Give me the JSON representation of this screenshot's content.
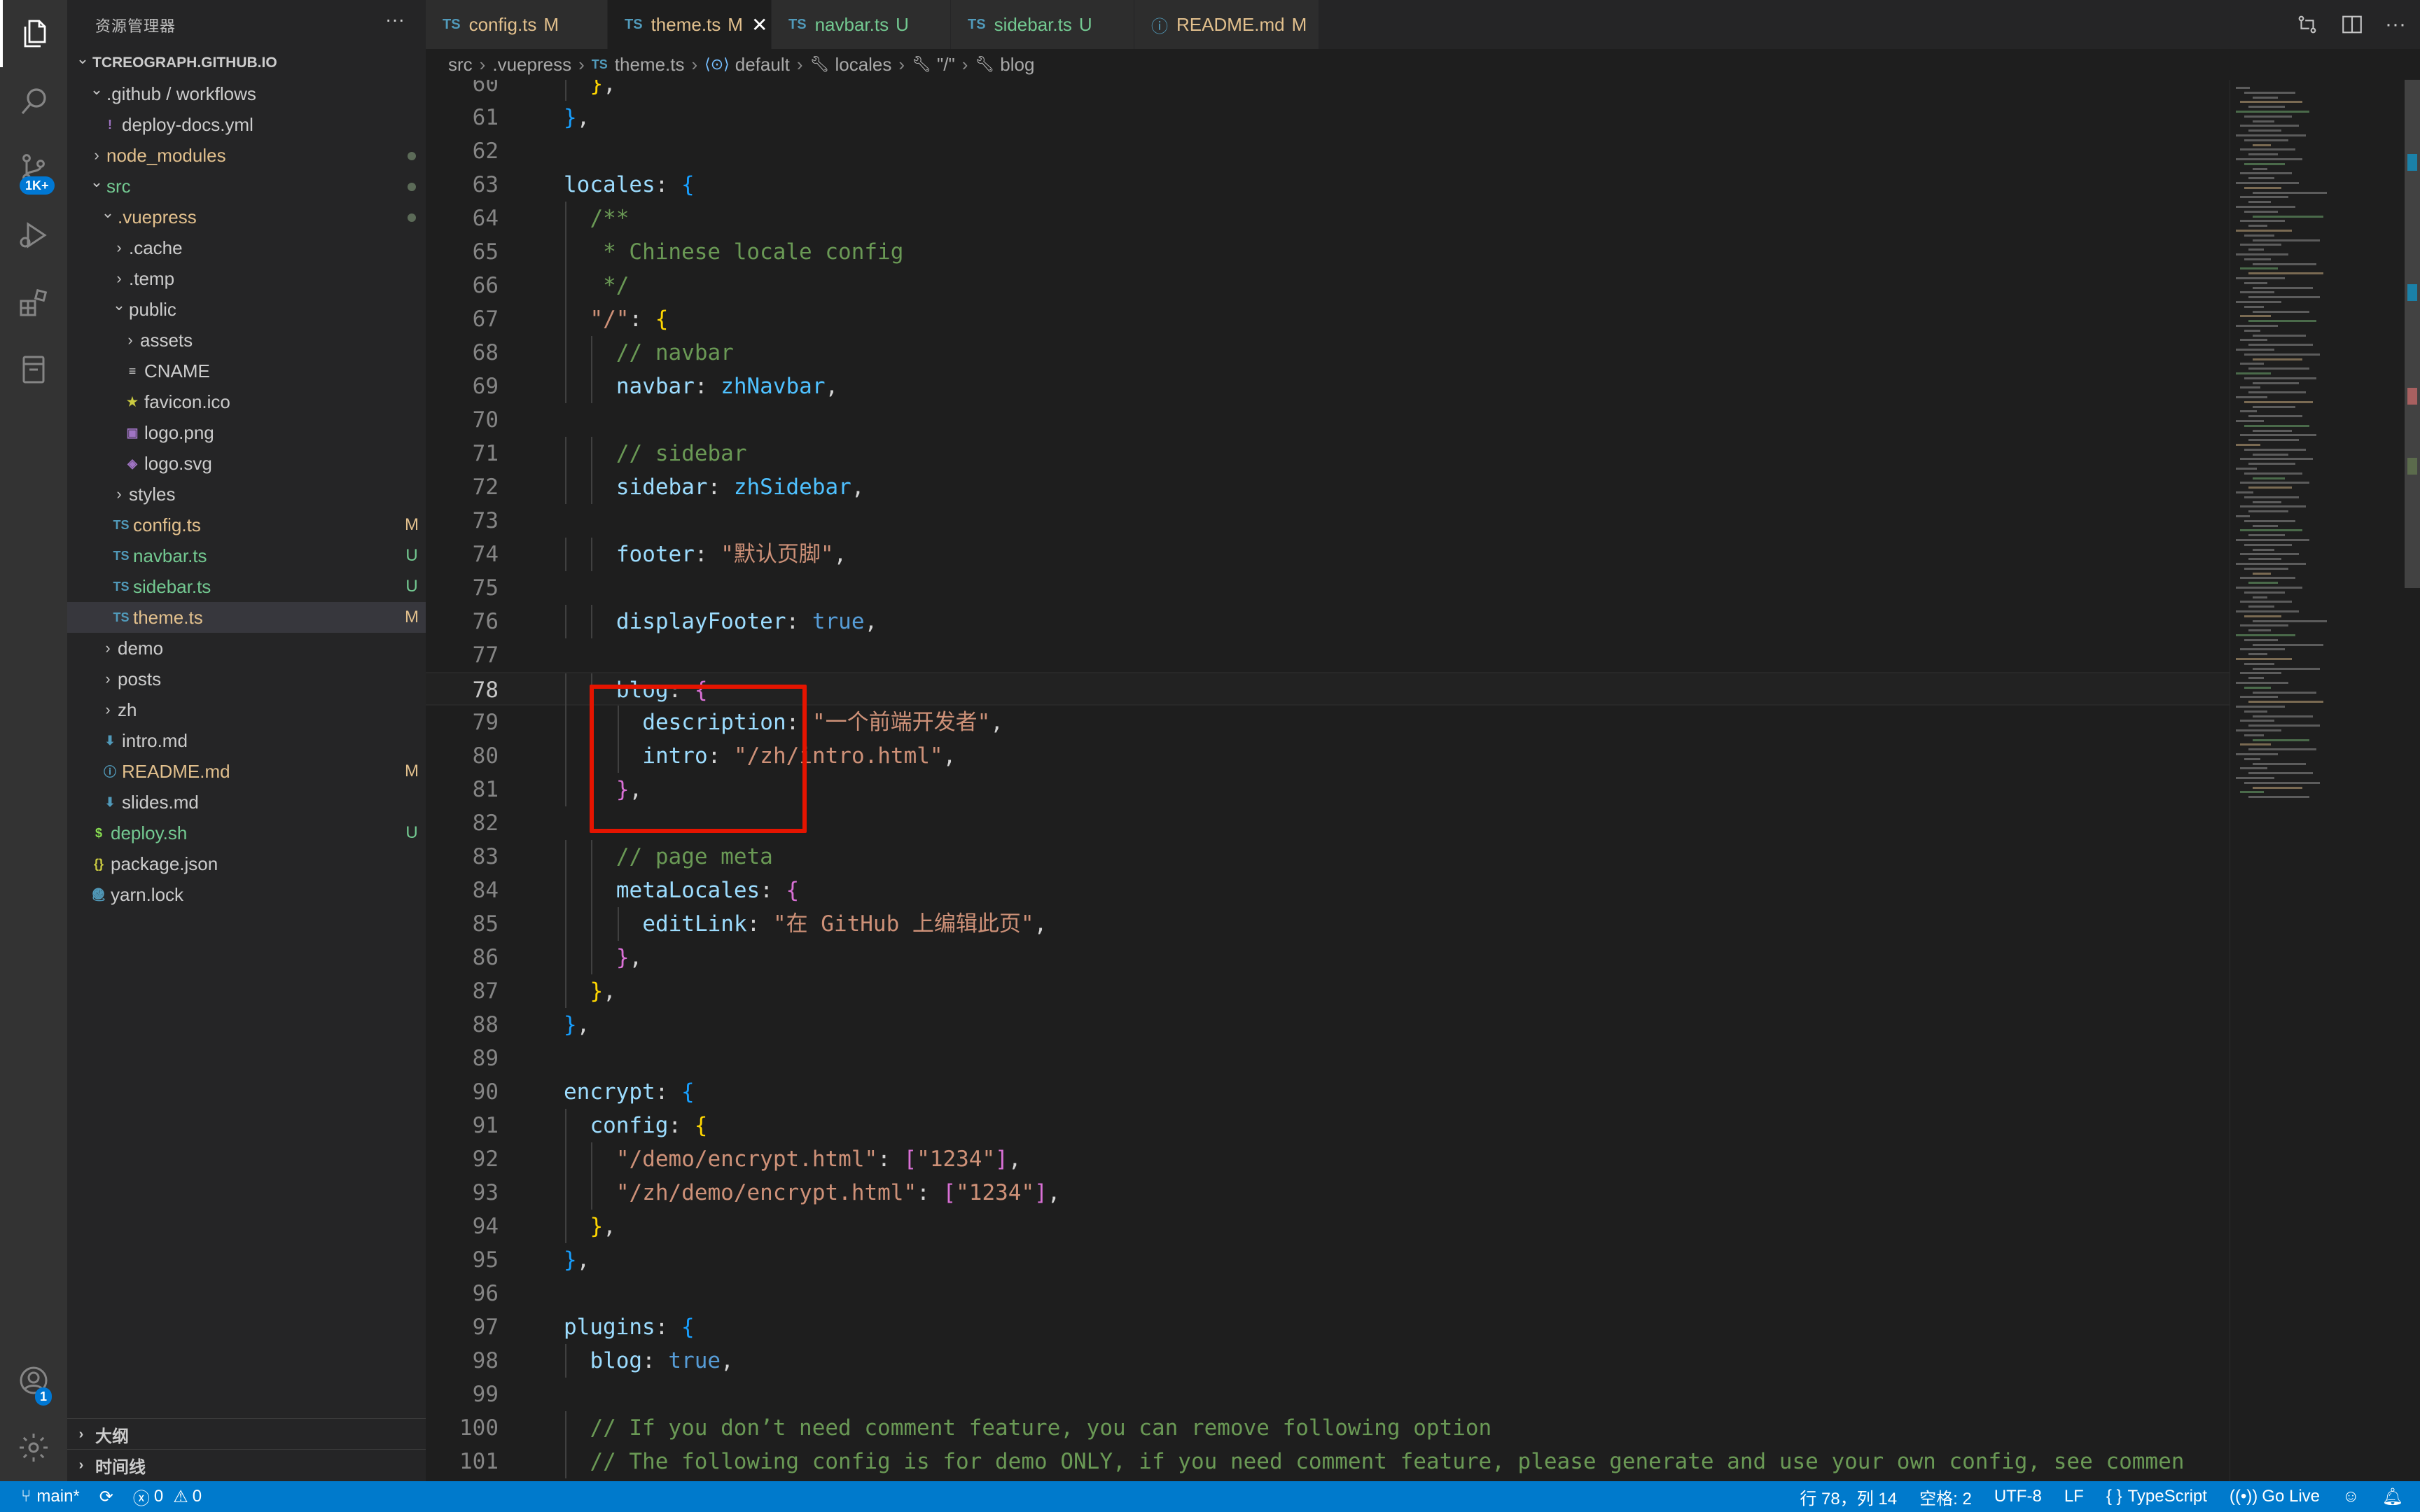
{
  "colors": {
    "accent": "#007acc",
    "modified": "#e2c08d",
    "untracked": "#73c991",
    "highlight_box": "#e51400"
  },
  "activity_bar": {
    "scm_badge": "1K+",
    "account_badge": "1"
  },
  "explorer": {
    "title": "资源管理器",
    "more": "···",
    "tree": [
      {
        "label": "TCREOGRAPH.GITHUB.IO",
        "type": "root",
        "depth": 0,
        "expanded": true,
        "status": ""
      },
      {
        "label": ".github / workflows",
        "type": "folder",
        "depth": 1,
        "expanded": true,
        "status": ""
      },
      {
        "label": "deploy-docs.yml",
        "type": "yml",
        "depth": 2,
        "status": ""
      },
      {
        "label": "node_modules",
        "type": "folder",
        "depth": 1,
        "expanded": false,
        "status": "dot",
        "color": "mod"
      },
      {
        "label": "src",
        "type": "folder",
        "depth": 1,
        "expanded": true,
        "status": "dot",
        "color": "new"
      },
      {
        "label": ".vuepress",
        "type": "folder",
        "depth": 2,
        "expanded": true,
        "status": "dot",
        "color": "mod"
      },
      {
        "label": ".cache",
        "type": "folder",
        "depth": 3,
        "expanded": false,
        "status": ""
      },
      {
        "label": ".temp",
        "type": "folder",
        "depth": 3,
        "expanded": false,
        "status": ""
      },
      {
        "label": "public",
        "type": "folder",
        "depth": 3,
        "expanded": true,
        "status": ""
      },
      {
        "label": "assets",
        "type": "folder",
        "depth": 4,
        "expanded": false,
        "status": ""
      },
      {
        "label": "CNAME",
        "type": "text",
        "depth": 4,
        "status": ""
      },
      {
        "label": "favicon.ico",
        "type": "star",
        "depth": 4,
        "status": ""
      },
      {
        "label": "logo.png",
        "type": "image",
        "depth": 4,
        "status": ""
      },
      {
        "label": "logo.svg",
        "type": "svg",
        "depth": 4,
        "status": ""
      },
      {
        "label": "styles",
        "type": "folder",
        "depth": 3,
        "expanded": false,
        "status": ""
      },
      {
        "label": "config.ts",
        "type": "ts",
        "depth": 3,
        "status": "M",
        "color": "mod"
      },
      {
        "label": "navbar.ts",
        "type": "ts",
        "depth": 3,
        "status": "U",
        "color": "new"
      },
      {
        "label": "sidebar.ts",
        "type": "ts",
        "depth": 3,
        "status": "U",
        "color": "new"
      },
      {
        "label": "theme.ts",
        "type": "ts",
        "depth": 3,
        "status": "M",
        "color": "mod",
        "selected": true
      },
      {
        "label": "demo",
        "type": "folder",
        "depth": 2,
        "expanded": false,
        "status": ""
      },
      {
        "label": "posts",
        "type": "folder",
        "depth": 2,
        "expanded": false,
        "status": ""
      },
      {
        "label": "zh",
        "type": "folder",
        "depth": 2,
        "expanded": false,
        "status": ""
      },
      {
        "label": "intro.md",
        "type": "md",
        "depth": 2,
        "status": ""
      },
      {
        "label": "README.md",
        "type": "info",
        "depth": 2,
        "status": "M",
        "color": "mod"
      },
      {
        "label": "slides.md",
        "type": "md",
        "depth": 2,
        "status": ""
      },
      {
        "label": "deploy.sh",
        "type": "sh",
        "depth": 1,
        "status": "U",
        "color": "new"
      },
      {
        "label": "package.json",
        "type": "json",
        "depth": 1,
        "status": ""
      },
      {
        "label": "yarn.lock",
        "type": "lock",
        "depth": 1,
        "status": ""
      }
    ],
    "outline": "大纲",
    "timeline": "时间线"
  },
  "tabs": [
    {
      "label": "config.ts",
      "status": "M",
      "kind": "TS",
      "color": "mod",
      "active": false
    },
    {
      "label": "theme.ts",
      "status": "M",
      "kind": "TS",
      "color": "mod",
      "active": true
    },
    {
      "label": "navbar.ts",
      "status": "U",
      "kind": "TS",
      "color": "new",
      "active": false
    },
    {
      "label": "sidebar.ts",
      "status": "U",
      "kind": "TS",
      "color": "new",
      "active": false
    },
    {
      "label": "README.md",
      "status": "M",
      "kind": "info",
      "color": "mod",
      "active": false
    }
  ],
  "breadcrumb": {
    "src": "src",
    "vuepress": ".vuepress",
    "ts_tag": "TS",
    "file": "theme.ts",
    "default": "default",
    "locales": "locales",
    "root": "\"/\"",
    "blog": "blog"
  },
  "editor": {
    "current_line": 78,
    "lines": [
      {
        "n": 60,
        "indent": 1,
        "tokens": [
          [
            "}",
            "b1"
          ],
          [
            ",",
            "pl"
          ]
        ]
      },
      {
        "n": 61,
        "indent": 0,
        "tokens": [
          [
            "}",
            "b3"
          ],
          [
            ",",
            "pl"
          ]
        ]
      },
      {
        "n": 62,
        "indent": 0,
        "tokens": []
      },
      {
        "n": 63,
        "indent": 0,
        "tokens": [
          [
            "locales",
            "kw"
          ],
          [
            ": ",
            "pl"
          ],
          [
            "{",
            "b3"
          ]
        ]
      },
      {
        "n": 64,
        "indent": 1,
        "tokens": [
          [
            "/**",
            "cm"
          ]
        ]
      },
      {
        "n": 65,
        "indent": 1,
        "tokens": [
          [
            " * Chinese locale config",
            "cm"
          ]
        ]
      },
      {
        "n": 66,
        "indent": 1,
        "tokens": [
          [
            " */",
            "cm"
          ]
        ]
      },
      {
        "n": 67,
        "indent": 1,
        "tokens": [
          [
            "\"/\"",
            "str"
          ],
          [
            ": ",
            "pl"
          ],
          [
            "{",
            "b1"
          ]
        ]
      },
      {
        "n": 68,
        "indent": 2,
        "tokens": [
          [
            "// navbar",
            "cm"
          ]
        ]
      },
      {
        "n": 69,
        "indent": 2,
        "tokens": [
          [
            "navbar",
            "kw"
          ],
          [
            ": ",
            "pl"
          ],
          [
            "zhNavbar",
            "var"
          ],
          [
            ",",
            "pl"
          ]
        ]
      },
      {
        "n": 70,
        "indent": 0,
        "tokens": []
      },
      {
        "n": 71,
        "indent": 2,
        "tokens": [
          [
            "// sidebar",
            "cm"
          ]
        ]
      },
      {
        "n": 72,
        "indent": 2,
        "tokens": [
          [
            "sidebar",
            "kw"
          ],
          [
            ": ",
            "pl"
          ],
          [
            "zhSidebar",
            "var"
          ],
          [
            ",",
            "pl"
          ]
        ]
      },
      {
        "n": 73,
        "indent": 0,
        "tokens": []
      },
      {
        "n": 74,
        "indent": 2,
        "tokens": [
          [
            "footer",
            "kw"
          ],
          [
            ": ",
            "pl"
          ],
          [
            "\"默认页脚\"",
            "str"
          ],
          [
            ",",
            "pl"
          ]
        ]
      },
      {
        "n": 75,
        "indent": 0,
        "tokens": []
      },
      {
        "n": 76,
        "indent": 2,
        "tokens": [
          [
            "displayFooter",
            "kw"
          ],
          [
            ": ",
            "pl"
          ],
          [
            "true",
            "bool"
          ],
          [
            ",",
            "pl"
          ]
        ]
      },
      {
        "n": 77,
        "indent": 0,
        "tokens": []
      },
      {
        "n": 78,
        "indent": 2,
        "tokens": [
          [
            "blog",
            "kw"
          ],
          [
            ": ",
            "pl"
          ],
          [
            "{",
            "b2"
          ]
        ]
      },
      {
        "n": 79,
        "indent": 3,
        "tokens": [
          [
            "description",
            "kw"
          ],
          [
            ": ",
            "pl"
          ],
          [
            "\"一个前端开发者\"",
            "str"
          ],
          [
            ",",
            "pl"
          ]
        ]
      },
      {
        "n": 80,
        "indent": 3,
        "tokens": [
          [
            "intro",
            "kw"
          ],
          [
            ": ",
            "pl"
          ],
          [
            "\"/zh/intro.html\"",
            "str"
          ],
          [
            ",",
            "pl"
          ]
        ]
      },
      {
        "n": 81,
        "indent": 2,
        "tokens": [
          [
            "}",
            "b2"
          ],
          [
            ",",
            "pl"
          ]
        ]
      },
      {
        "n": 82,
        "indent": 0,
        "tokens": []
      },
      {
        "n": 83,
        "indent": 2,
        "tokens": [
          [
            "// page meta",
            "cm"
          ]
        ]
      },
      {
        "n": 84,
        "indent": 2,
        "tokens": [
          [
            "metaLocales",
            "kw"
          ],
          [
            ": ",
            "pl"
          ],
          [
            "{",
            "b2"
          ]
        ]
      },
      {
        "n": 85,
        "indent": 3,
        "tokens": [
          [
            "editLink",
            "kw"
          ],
          [
            ": ",
            "pl"
          ],
          [
            "\"在 GitHub 上编辑此页\"",
            "str"
          ],
          [
            ",",
            "pl"
          ]
        ]
      },
      {
        "n": 86,
        "indent": 2,
        "tokens": [
          [
            "}",
            "b2"
          ],
          [
            ",",
            "pl"
          ]
        ]
      },
      {
        "n": 87,
        "indent": 1,
        "tokens": [
          [
            "}",
            "b1"
          ],
          [
            ",",
            "pl"
          ]
        ]
      },
      {
        "n": 88,
        "indent": 0,
        "tokens": [
          [
            "}",
            "b3"
          ],
          [
            ",",
            "pl"
          ]
        ]
      },
      {
        "n": 89,
        "indent": 0,
        "tokens": []
      },
      {
        "n": 90,
        "indent": 0,
        "tokens": [
          [
            "encrypt",
            "kw"
          ],
          [
            ": ",
            "pl"
          ],
          [
            "{",
            "b3"
          ]
        ]
      },
      {
        "n": 91,
        "indent": 1,
        "tokens": [
          [
            "config",
            "kw"
          ],
          [
            ": ",
            "pl"
          ],
          [
            "{",
            "b1"
          ]
        ]
      },
      {
        "n": 92,
        "indent": 2,
        "tokens": [
          [
            "\"/demo/encrypt.html\"",
            "str"
          ],
          [
            ": ",
            "pl"
          ],
          [
            "[",
            "b2"
          ],
          [
            "\"1234\"",
            "str"
          ],
          [
            "]",
            "b2"
          ],
          [
            ",",
            "pl"
          ]
        ]
      },
      {
        "n": 93,
        "indent": 2,
        "tokens": [
          [
            "\"/zh/demo/encrypt.html\"",
            "str"
          ],
          [
            ": ",
            "pl"
          ],
          [
            "[",
            "b2"
          ],
          [
            "\"1234\"",
            "str"
          ],
          [
            "]",
            "b2"
          ],
          [
            ",",
            "pl"
          ]
        ]
      },
      {
        "n": 94,
        "indent": 1,
        "tokens": [
          [
            "}",
            "b1"
          ],
          [
            ",",
            "pl"
          ]
        ]
      },
      {
        "n": 95,
        "indent": 0,
        "tokens": [
          [
            "}",
            "b3"
          ],
          [
            ",",
            "pl"
          ]
        ]
      },
      {
        "n": 96,
        "indent": 0,
        "tokens": []
      },
      {
        "n": 97,
        "indent": 0,
        "tokens": [
          [
            "plugins",
            "kw"
          ],
          [
            ": ",
            "pl"
          ],
          [
            "{",
            "b3"
          ]
        ]
      },
      {
        "n": 98,
        "indent": 1,
        "tokens": [
          [
            "blog",
            "kw"
          ],
          [
            ": ",
            "pl"
          ],
          [
            "true",
            "bool"
          ],
          [
            ",",
            "pl"
          ]
        ]
      },
      {
        "n": 99,
        "indent": 0,
        "tokens": []
      },
      {
        "n": 100,
        "indent": 1,
        "tokens": [
          [
            "// If you don’t need comment feature, you can remove following option",
            "cm"
          ]
        ]
      },
      {
        "n": 101,
        "indent": 1,
        "tokens": [
          [
            "// The following config is for demo ONLY, if you need comment feature, please generate and use your own config, see commen",
            "cm"
          ]
        ]
      }
    ]
  },
  "status_bar": {
    "branch": "main*",
    "errors": "0",
    "warnings": "0",
    "position": "行 78，列 14",
    "spaces": "空格: 2",
    "encoding": "UTF-8",
    "eol": "LF",
    "language": "TypeScript",
    "go_live": "Go Live"
  }
}
